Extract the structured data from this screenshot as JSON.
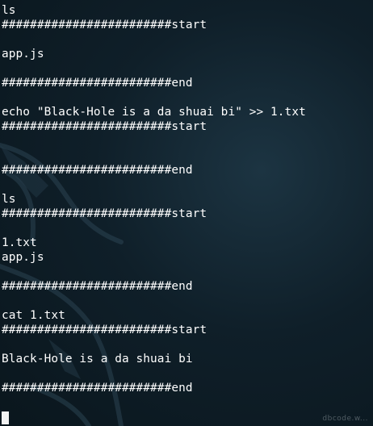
{
  "terminal": {
    "lines": [
      "ls",
      "########################start",
      "",
      "app.js",
      "",
      "########################end",
      "",
      "echo \"Black-Hole is a da shuai bi\" >> 1.txt",
      "########################start",
      "",
      "",
      "########################end",
      "",
      "ls",
      "########################start",
      "",
      "1.txt",
      "app.js",
      "",
      "########################end",
      "",
      "cat 1.txt",
      "########################start",
      "",
      "Black-Hole is a da shuai bi",
      "",
      "########################end"
    ]
  },
  "watermark": "dbcode.w..."
}
